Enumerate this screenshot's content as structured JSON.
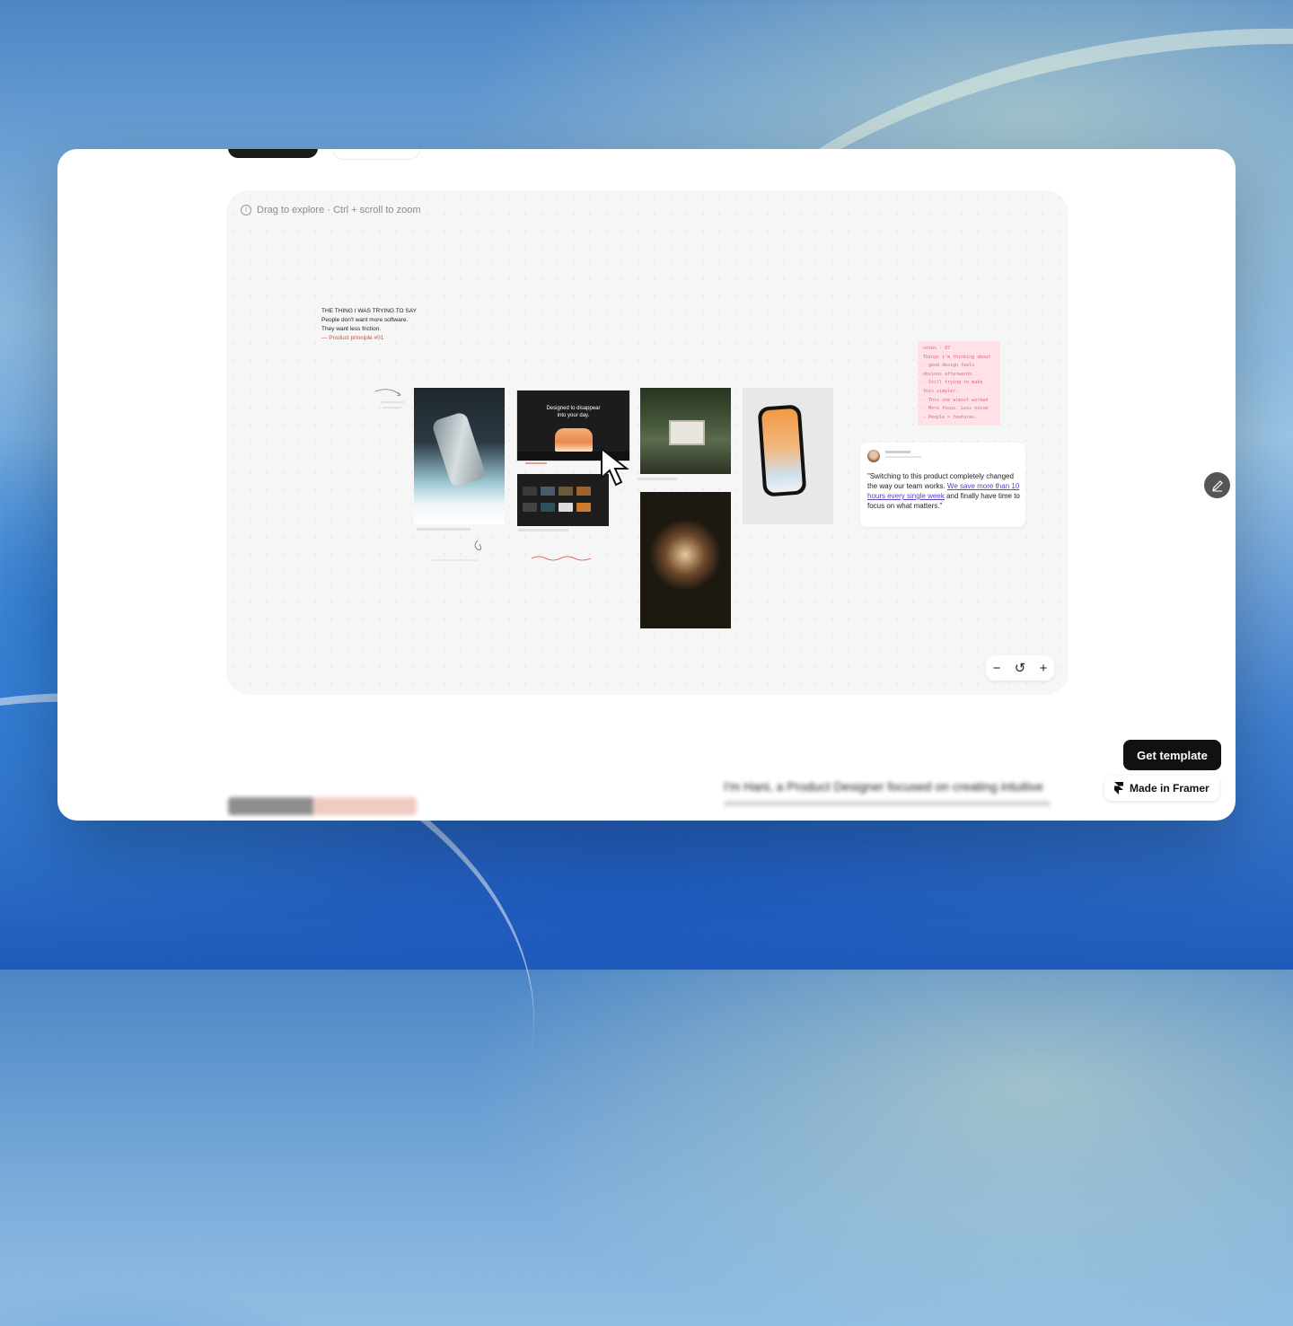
{
  "canvas": {
    "hint": "Drag to explore · Ctrl + scroll to zoom"
  },
  "quote": {
    "heading": "THE THING I WAS TRYING TO SAY",
    "line1": "People don't want more software.",
    "line2": "They want less friction.",
    "attribution": "— Product principle #01"
  },
  "promo": {
    "title_line1": "Designed to disappear",
    "title_line2": "into your day."
  },
  "note": {
    "lines": [
      "notes · 07",
      "Things i'm thinking about",
      "- good design feels",
      "obvious afterwards.",
      "- Still trying to make",
      "this simpler.",
      "- This one almost worked",
      "- More focus. Less noise",
      "- People > features."
    ]
  },
  "testimonial": {
    "body_start": "\"Switching to this product completely changed the way our team works. ",
    "highlight": "We save more than 10 hours every single week",
    "body_end": " and finally have time to focus on what matters.\""
  },
  "zoom": {
    "minus": "−",
    "reset": "↺",
    "plus": "+"
  },
  "cta": {
    "get_template": "Get template",
    "made_in_framer": "Made in Framer"
  },
  "footer": {
    "intro_text": "I'm Hani, a Product Designer focused on creating intuitive"
  },
  "colors": {
    "accent": "#d0503a",
    "highlight": "#5a3fc4",
    "note_bg": "#ffe1e7"
  }
}
